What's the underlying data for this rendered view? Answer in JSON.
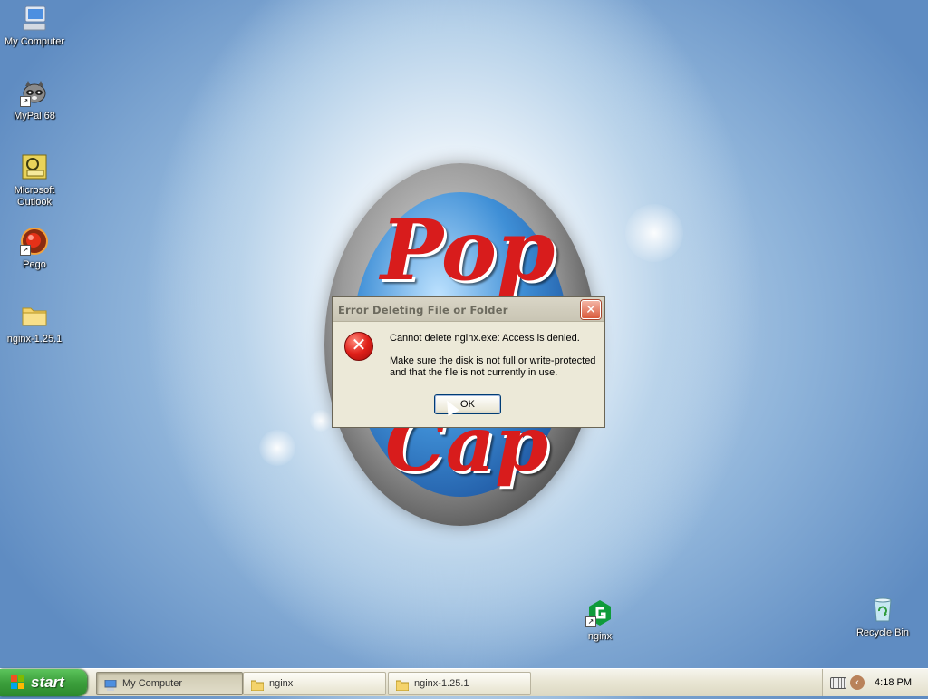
{
  "desktop": {
    "icons": [
      {
        "label": "My Computer"
      },
      {
        "label": "MyPal 68"
      },
      {
        "label": "Microsoft Outlook"
      },
      {
        "label": "Pego"
      },
      {
        "label": "nginx-1.25.1"
      },
      {
        "label": "nginx"
      },
      {
        "label": "Recycle Bin"
      }
    ],
    "wallpaper_logo": {
      "line1": "Pop",
      "line2": "Cap"
    }
  },
  "dialog": {
    "title": "Error Deleting File or Folder",
    "message_line1": "Cannot delete nginx.exe: Access is denied.",
    "message_line2": "Make sure the disk is not full or write-protected",
    "message_line3": "and that the file is not currently in use.",
    "ok_label": "OK",
    "close_glyph": "✕",
    "icon": "error-icon"
  },
  "taskbar": {
    "start_label": "start",
    "tasks": [
      {
        "label": "My Computer",
        "icon": "computer-icon",
        "active": true
      },
      {
        "label": "nginx",
        "icon": "folder-icon",
        "active": false
      },
      {
        "label": "nginx-1.25.1",
        "icon": "folder-icon",
        "active": false
      }
    ],
    "clock": "4:18 PM"
  },
  "colors": {
    "error_red": "#e0201a",
    "start_green": "#3c9f3c",
    "dialog_bg": "#ece9d8"
  }
}
